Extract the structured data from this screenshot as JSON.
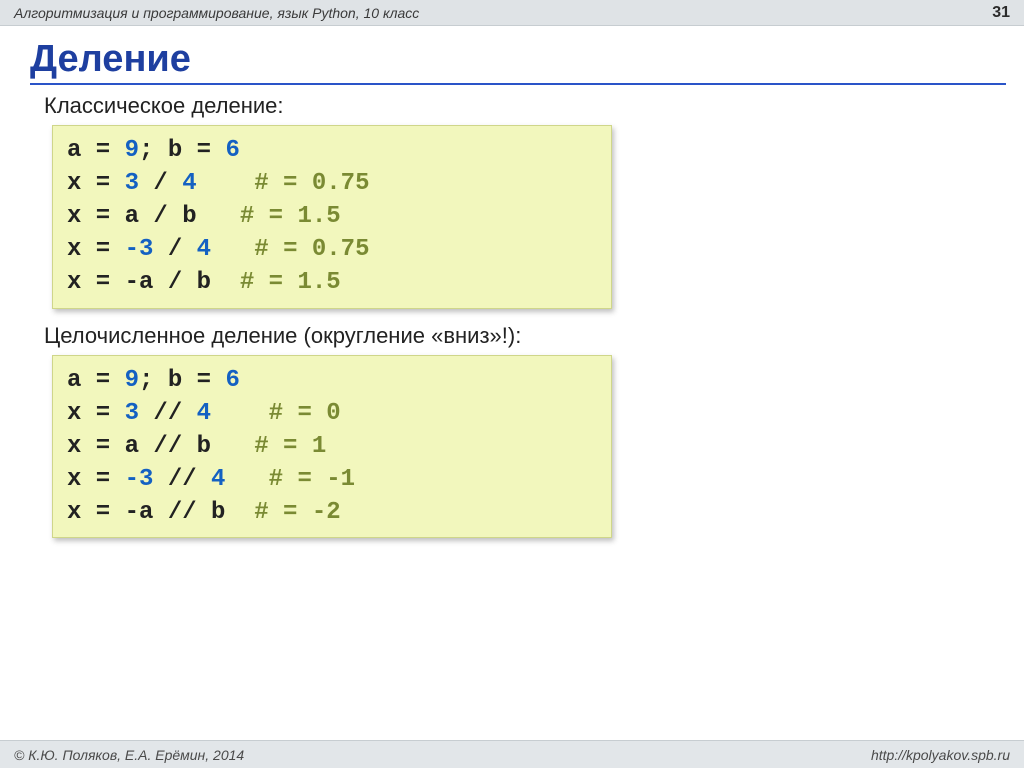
{
  "header": {
    "course": "Алгоритмизация и программирование, язык Python, 10 класс",
    "page_number": "31"
  },
  "title": "Деление",
  "section1": {
    "label": "Классическое деление:",
    "code": {
      "l1": {
        "t1": "a = ",
        "n1": "9",
        "t2": "; b = ",
        "n2": "6"
      },
      "l2": {
        "t1": "x = ",
        "n1": "3",
        "t2": " / ",
        "n2": "4",
        "pad": "    ",
        "c": "# = 0.75"
      },
      "l3": {
        "t1": "x = a / b   ",
        "c": "# = 1.5"
      },
      "l4": {
        "t1": "x = ",
        "n1": "-3",
        "t2": " / ",
        "n2": "4",
        "pad": "   ",
        "c": "# = 0.75"
      },
      "l5": {
        "t1": "x = -a / b  ",
        "c": "# = 1.5"
      }
    }
  },
  "section2": {
    "label": "Целочисленное деление (округление «вниз»!):",
    "code": {
      "l1": {
        "t1": "a = ",
        "n1": "9",
        "t2": "; b = ",
        "n2": "6"
      },
      "l2": {
        "t1": "x = ",
        "n1": "3",
        "t2": " // ",
        "n2": "4",
        "pad": "    ",
        "c": "# = 0"
      },
      "l3": {
        "t1": "x = a // b   ",
        "c": "# = 1"
      },
      "l4": {
        "t1": "x = ",
        "n1": "-3",
        "t2": " // ",
        "n2": "4",
        "pad": "   ",
        "c": "# = -1"
      },
      "l5": {
        "t1": "x = -a // b  ",
        "c": "# = -2"
      }
    }
  },
  "footer": {
    "copyright": "© К.Ю. Поляков, Е.А. Ерёмин, 2014",
    "url": "http://kpolyakov.spb.ru"
  }
}
